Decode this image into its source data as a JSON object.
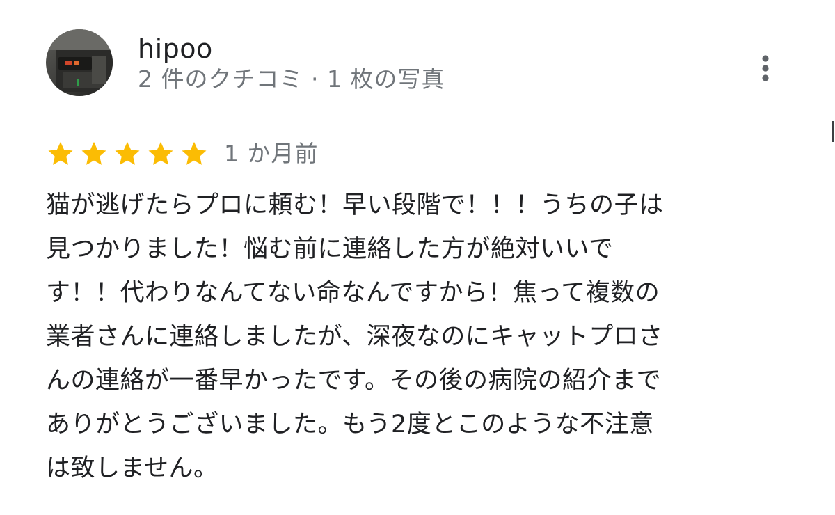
{
  "review": {
    "author": {
      "name": "hipoo",
      "meta": "2 件のクチコミ · 1 枚の写真"
    },
    "rating": 5,
    "rating_max": 5,
    "date": "1 か月前",
    "text_lines": [
      "猫が逃げたらプロに頼む！早い段階で！！！うちの子は",
      "見つかりました！悩む前に連絡した方が絶対いいで",
      "す！！代わりなんてない命なんですから！焦って複数の",
      "業者さんに連絡しましたが、深夜なのにキャットプロさ",
      "んの連絡が一番早かったです。その後の病院の紹介まで",
      "ありがとうございました。もう2度とこのような不注意",
      "は致しません。"
    ]
  },
  "icons": {
    "more": "more-vert-icon",
    "star": "star-icon"
  },
  "colors": {
    "star": "#fbbc04",
    "text_primary": "#202124",
    "text_secondary": "#70757a"
  }
}
